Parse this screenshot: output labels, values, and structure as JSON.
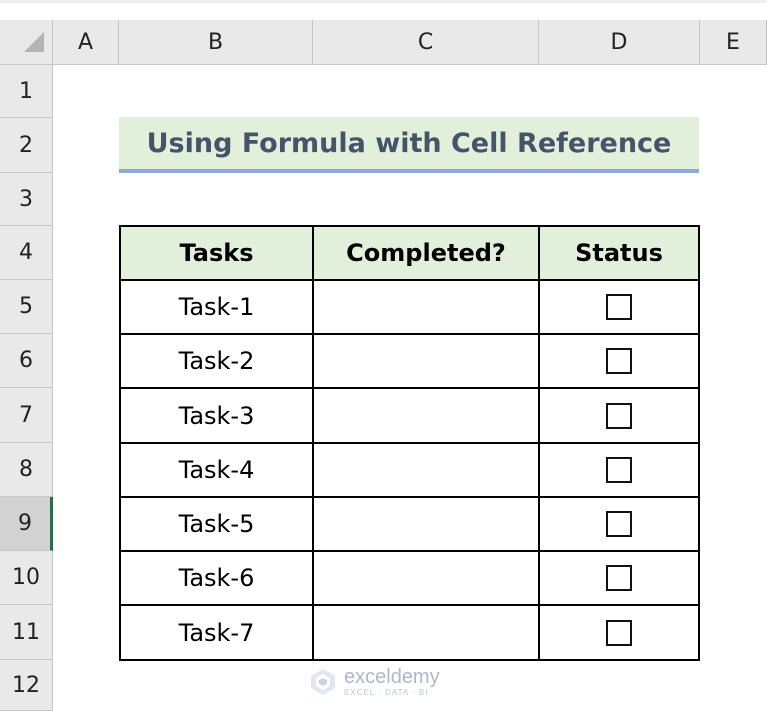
{
  "columns": [
    "A",
    "B",
    "C",
    "D",
    "E"
  ],
  "rows": [
    "1",
    "2",
    "3",
    "4",
    "5",
    "6",
    "7",
    "8",
    "9",
    "10",
    "11",
    "12"
  ],
  "title": "Using Formula with Cell Reference",
  "table": {
    "headers": [
      "Tasks",
      "Completed?",
      "Status"
    ],
    "tasks": [
      "Task-1",
      "Task-2",
      "Task-3",
      "Task-4",
      "Task-5",
      "Task-6",
      "Task-7"
    ],
    "completed": [
      "",
      "",
      "",
      "",
      "",
      "",
      ""
    ],
    "status_checked": [
      false,
      false,
      false,
      false,
      false,
      false,
      false
    ]
  },
  "watermark": {
    "name": "exceldemy",
    "tagline": "EXCEL · DATA · BI",
    "icon": "exceldemy-logo-icon"
  },
  "colors": {
    "header_fill": "#e2efda",
    "title_text": "#44546a",
    "title_underline": "#8ea9db",
    "active_row_marker": "#217346"
  }
}
